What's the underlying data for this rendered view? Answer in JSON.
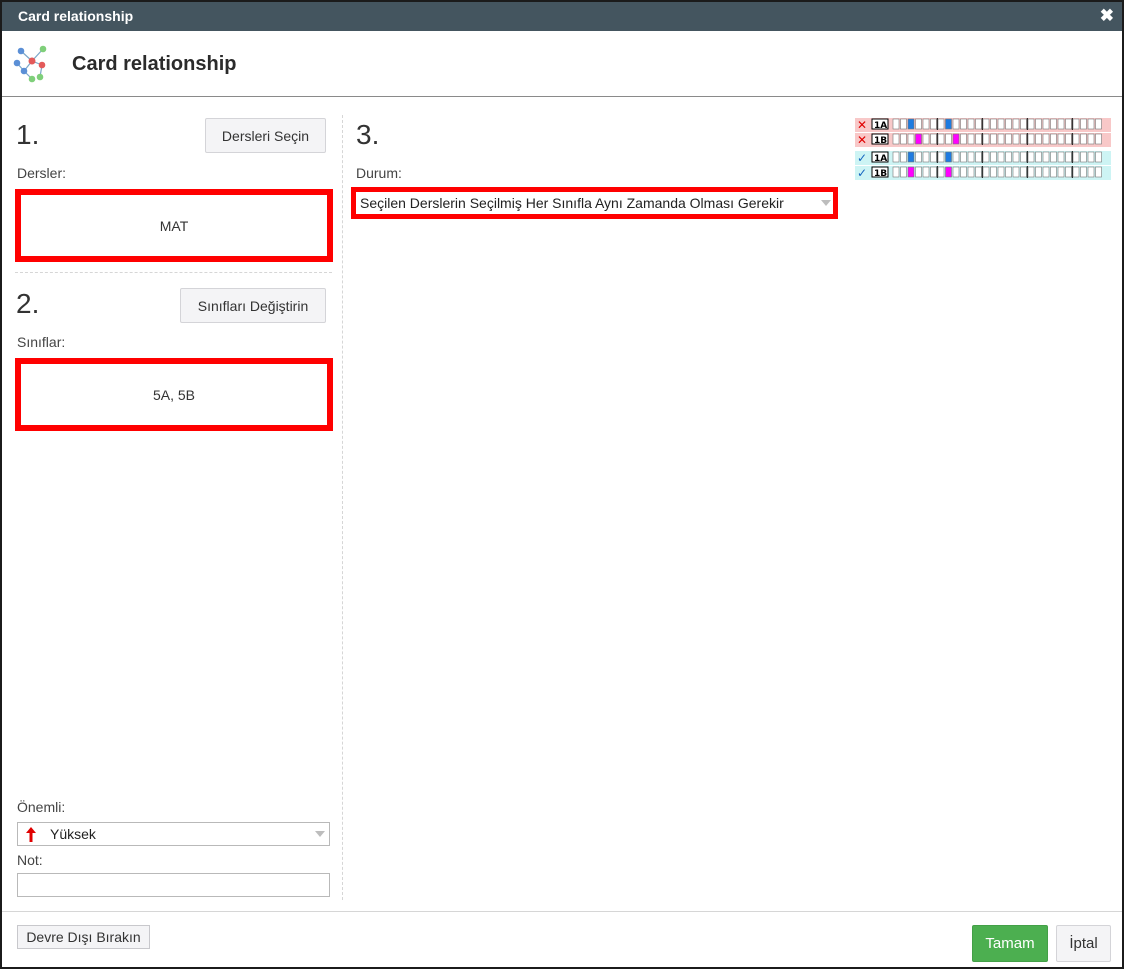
{
  "window": {
    "title": "Card relationship",
    "close_glyph": "✖"
  },
  "header": {
    "title": "Card relationship",
    "icon": "network-graph-icon"
  },
  "step1": {
    "number": "1.",
    "button_label": "Dersleri Seçin",
    "label": "Dersler:",
    "value": "MAT"
  },
  "step2": {
    "number": "2.",
    "button_label": "Sınıfları Değiştirin",
    "label": "Sınıflar:",
    "value": "5A, 5B"
  },
  "step3": {
    "number": "3.",
    "label": "Durum:",
    "selected": "Seçilen Derslerin Seçilmiş Her Sınıfla Aynı Zamanda Olması Gerekir"
  },
  "preview": {
    "rows": [
      {
        "status": "✕",
        "label": "1A",
        "type": "invalid",
        "marks": [
          2,
          7
        ],
        "mark_color": "#1e7be0"
      },
      {
        "status": "✕",
        "label": "1B",
        "type": "invalid",
        "marks": [
          3,
          8
        ],
        "mark_color": "#ff00ff"
      },
      {
        "status": "✓",
        "label": "1A",
        "type": "valid",
        "marks": [
          2,
          7
        ],
        "mark_color": "#1e7be0"
      },
      {
        "status": "✓",
        "label": "1B",
        "type": "valid",
        "marks": [
          2,
          7
        ],
        "mark_color": "#ff00ff"
      }
    ],
    "invalid_bg": "#f8c8c8",
    "valid_bg": "#cdf4f4"
  },
  "importance": {
    "label": "Önemli:",
    "value": "Yüksek",
    "icon": "arrow-up-icon"
  },
  "note": {
    "label": "Not:",
    "value": ""
  },
  "footer": {
    "disable_label": "Devre Dışı Bırakın",
    "ok_label": "Tamam",
    "cancel_label": "İptal"
  },
  "colors": {
    "titlebar": "#44555f",
    "ok": "#4caf50",
    "highlight": "#ff0000"
  }
}
